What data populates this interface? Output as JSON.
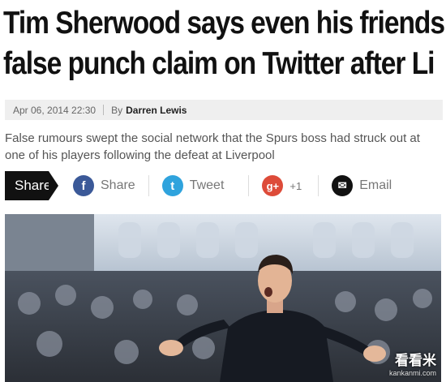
{
  "article": {
    "headline_line1": "Tim Sherwood says even his friends a",
    "headline_line2": "false punch claim on Twitter after Li",
    "date": "Apr 06, 2014 22:30",
    "by_label": "By",
    "author": "Darren Lewis",
    "standfirst": "False rumours swept the social network that the Spurs boss had struck out at one of his players following the defeat at Liverpool"
  },
  "share_bar": {
    "label": "Share",
    "buttons": [
      {
        "icon": "facebook-icon",
        "glyph": "f",
        "text": "Share",
        "color": "#3b5998"
      },
      {
        "icon": "twitter-icon",
        "glyph": "t",
        "text": "Tweet",
        "color": "#2fa3dd"
      },
      {
        "icon": "google-plus-icon",
        "glyph": "g+",
        "text": "+1",
        "color": "#dd4b39"
      },
      {
        "icon": "email-icon",
        "glyph": "✉",
        "text": "Email",
        "color": "#111111"
      }
    ]
  },
  "photo": {
    "watermark": "看看米",
    "watermark_sub": "kankanmi.com"
  }
}
